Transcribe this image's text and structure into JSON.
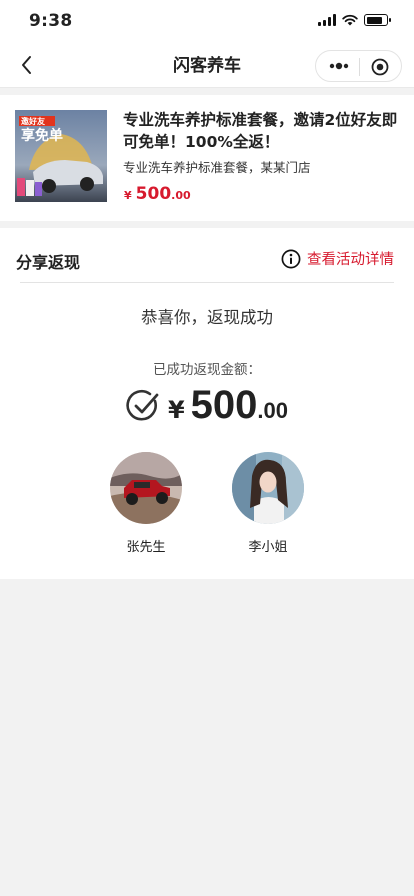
{
  "status_bar": {
    "time": "9:38"
  },
  "nav": {
    "title": "闪客养车"
  },
  "product": {
    "thumb_text_top": "邀好友",
    "thumb_text_main": "享免单",
    "title": "专业洗车养护标准套餐，邀请2位好友即可免单！100%全返！",
    "subtitle": "专业洗车养护标准套餐，某某门店",
    "price": {
      "currency": "¥",
      "integer": "500",
      "decimal": ".00"
    }
  },
  "share": {
    "heading": "分享返现",
    "detail_link": "查看活动详情",
    "congrats": "恭喜你，返现成功",
    "amount_label": "已成功返现金额：",
    "amount": {
      "currency": "¥",
      "integer": "500",
      "decimal": ".00"
    },
    "friends": [
      {
        "name": "张先生",
        "avatar": "jeep-photo"
      },
      {
        "name": "李小姐",
        "avatar": "girl-photo"
      }
    ]
  },
  "colors": {
    "accent": "#d71a2e",
    "background": "#f2f2f2"
  }
}
